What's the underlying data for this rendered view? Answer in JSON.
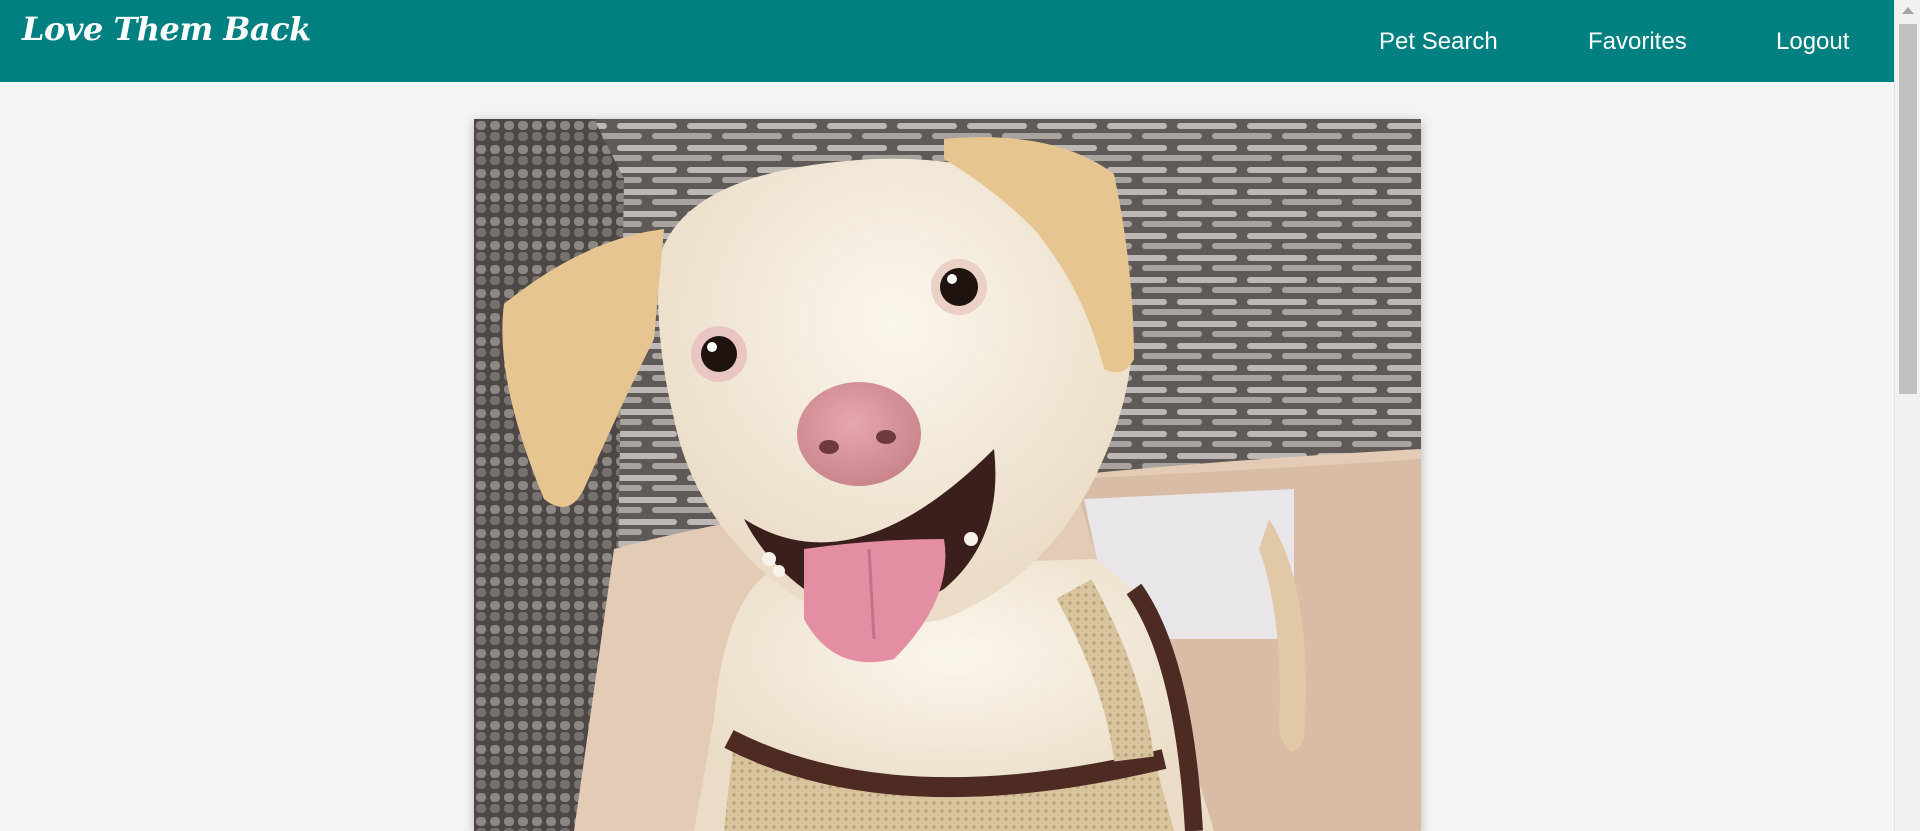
{
  "app": {
    "brand": "Love Them Back"
  },
  "nav": {
    "pet_search": "Pet Search",
    "favorites": "Favorites",
    "logout": "Logout"
  },
  "pet": {
    "photo_alt": "Smiling cream-colored dog wearing a harness"
  },
  "colors": {
    "navbar": "#008080",
    "background": "#f4f4f4",
    "nav_text": "#ffffff"
  },
  "icons": {
    "scroll_up": "scroll-up-arrow-icon"
  }
}
